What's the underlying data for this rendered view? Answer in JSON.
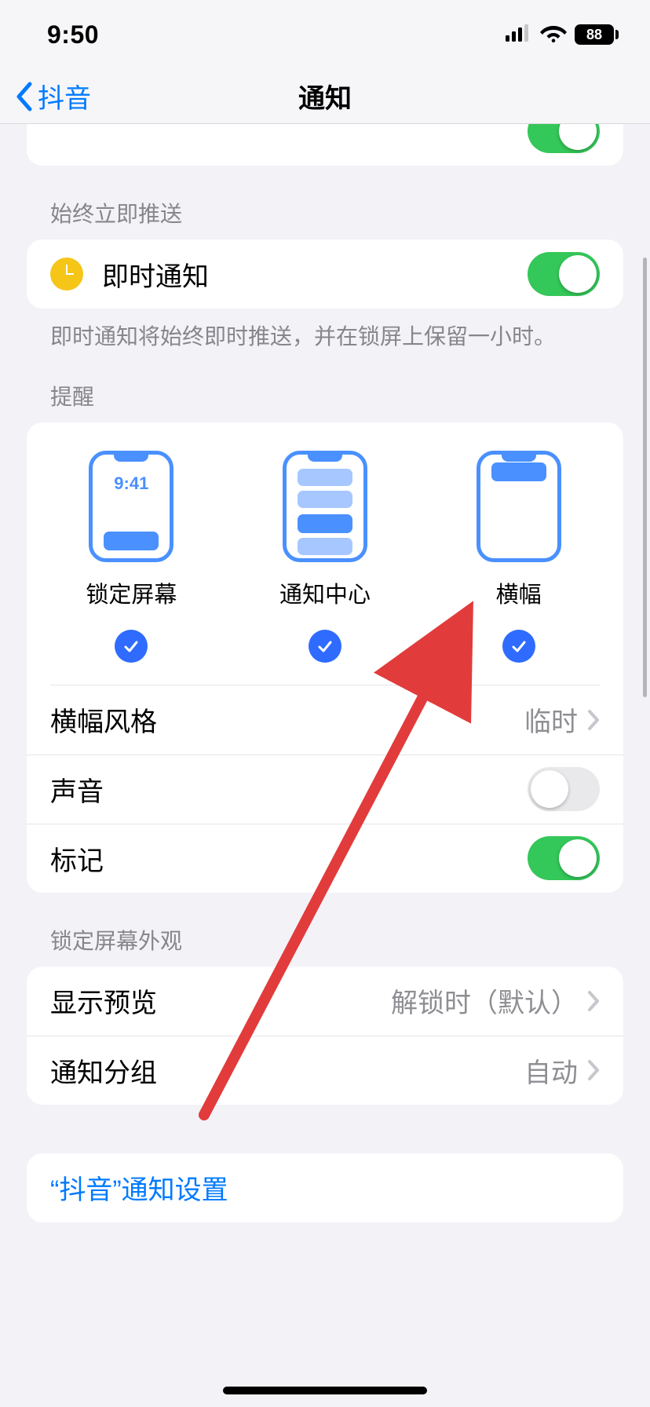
{
  "status": {
    "time": "9:50",
    "battery": "88"
  },
  "nav": {
    "back": "抖音",
    "title": "通知"
  },
  "immediate": {
    "header": "始终立即推送",
    "label": "即时通知",
    "footer": "即时通知将始终即时推送，并在锁屏上保留一小时。"
  },
  "alerts": {
    "header": "提醒",
    "lock": {
      "label": "锁定屏幕",
      "mini_time": "9:41"
    },
    "center": {
      "label": "通知中心"
    },
    "banner": {
      "label": "横幅"
    },
    "banner_style": {
      "label": "横幅风格",
      "value": "临时"
    },
    "sounds": {
      "label": "声音"
    },
    "badges": {
      "label": "标记"
    }
  },
  "lockscreen": {
    "header": "锁定屏幕外观",
    "previews": {
      "label": "显示预览",
      "value": "解锁时（默认）"
    },
    "grouping": {
      "label": "通知分组",
      "value": "自动"
    }
  },
  "app_settings": {
    "label": "“抖音”通知设置"
  }
}
